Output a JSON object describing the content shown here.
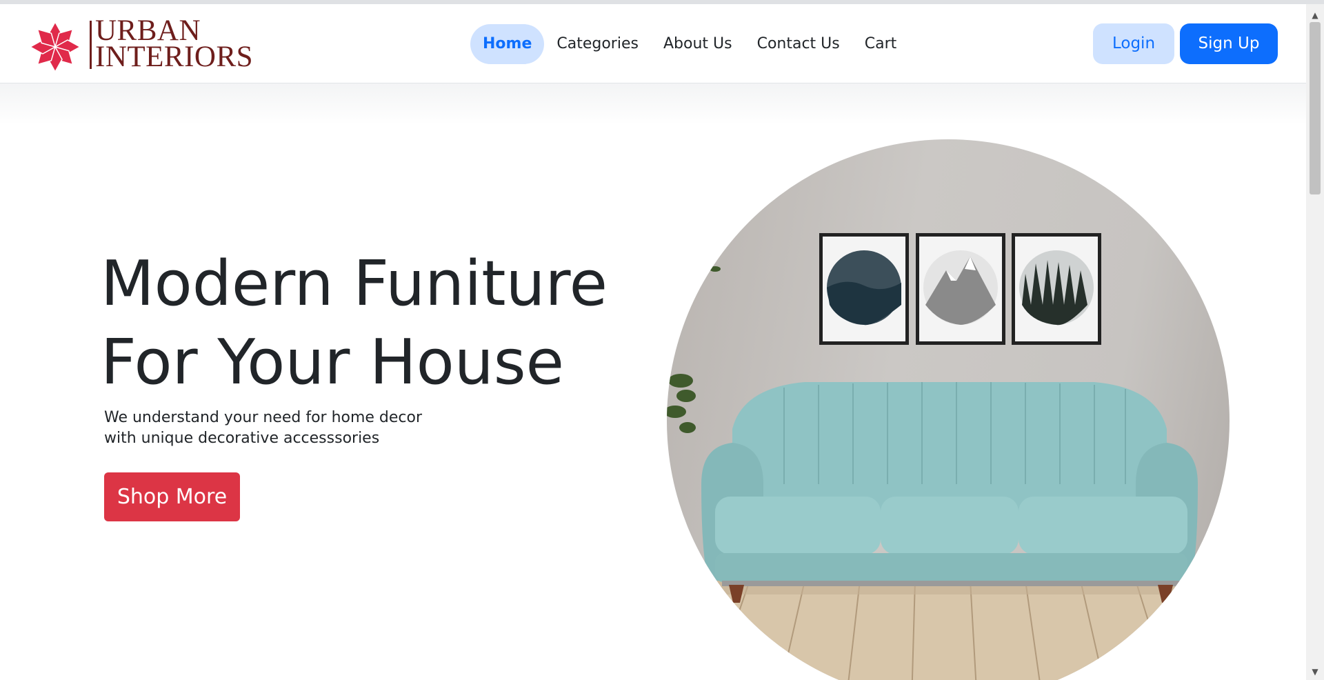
{
  "navbar": {
    "brand": {
      "line1": "URBAN",
      "line2": "INTERIORS",
      "logo_icon": "flower-logo-icon",
      "logo_color": "#e02a4a",
      "text_color": "#6e1e1c"
    },
    "links": [
      {
        "label": "Home",
        "active": true
      },
      {
        "label": "Categories",
        "active": false
      },
      {
        "label": "About Us",
        "active": false
      },
      {
        "label": "Contact Us",
        "active": false
      },
      {
        "label": "Cart",
        "active": false
      }
    ],
    "login_label": "Login",
    "signup_label": "Sign Up"
  },
  "hero": {
    "title_line1": "Modern Funiture",
    "title_line2": "For Your House",
    "subtitle_line1": "We understand your need for home decor",
    "subtitle_line2": "with unique decorative accesssories",
    "cta_label": "Shop More",
    "image": "living-room-sofa-image"
  },
  "colors": {
    "primary": "#0d6efd",
    "primary_light": "#cfe2ff",
    "danger": "#dc3545",
    "text": "#212529",
    "sofa": "#8fc3c4"
  },
  "icons": {
    "scroll_up": "▲",
    "scroll_down": "▼"
  }
}
